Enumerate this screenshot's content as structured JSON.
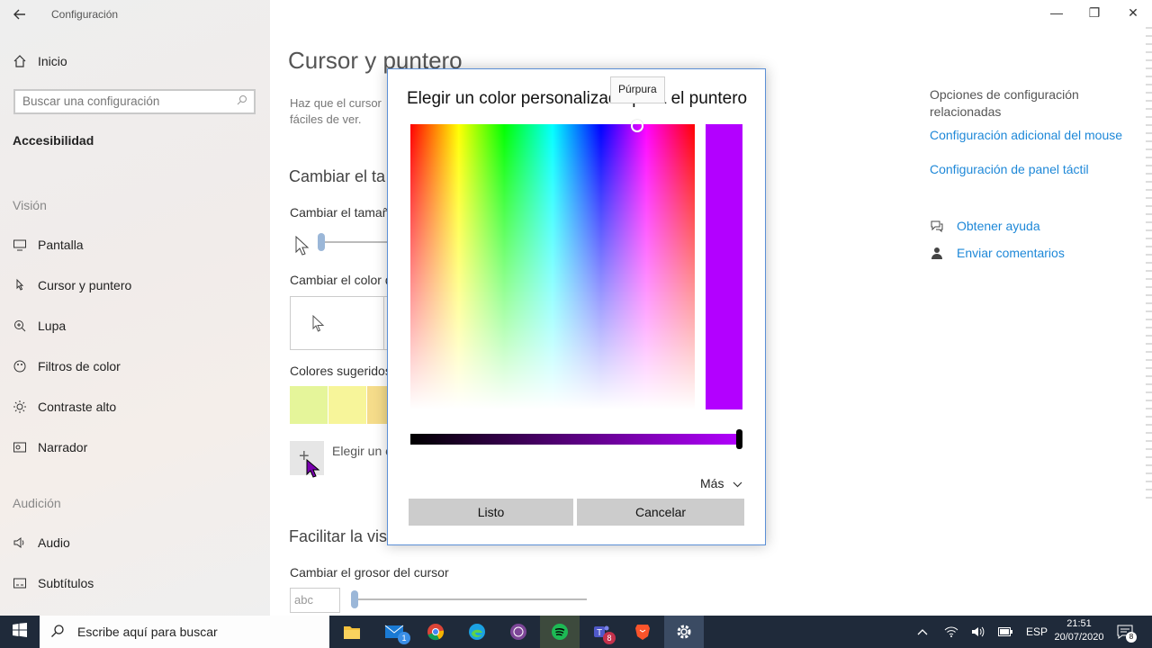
{
  "window": {
    "title": "Configuración",
    "minimize": "—",
    "maximize": "❐",
    "close": "✕"
  },
  "sidebar": {
    "home_label": "Inicio",
    "search_placeholder": "Buscar una configuración",
    "category": "Accesibilidad",
    "section_vision": "Visión",
    "items_vision": [
      {
        "label": "Pantalla",
        "icon": "monitor-icon"
      },
      {
        "label": "Cursor y puntero",
        "icon": "cursor-icon"
      },
      {
        "label": "Lupa",
        "icon": "magnifier-icon"
      },
      {
        "label": "Filtros de color",
        "icon": "color-filter-icon"
      },
      {
        "label": "Contraste alto",
        "icon": "brightness-icon"
      },
      {
        "label": "Narrador",
        "icon": "narrator-icon"
      }
    ],
    "section_audio": "Audición",
    "items_audio": [
      {
        "label": "Audio",
        "icon": "speaker-icon"
      },
      {
        "label": "Subtítulos",
        "icon": "captions-icon"
      }
    ]
  },
  "main": {
    "title": "Cursor y puntero",
    "description": "Haz que el cursor, … fáciles de ver.",
    "desc_line1": "Haz que el cursor",
    "desc_line2": "fáciles de ver.",
    "size_heading": "Cambiar el ta",
    "size_label": "Cambiar el tamañ",
    "color_label": "Cambiar el color d",
    "suggested_label": "Colores sugeridos",
    "suggested_colors": [
      "#e5f59a",
      "#f7f59a",
      "#f5dc8a"
    ],
    "custom_label": "Elegir un c",
    "ease_heading": "Facilitar la vis",
    "thickness_label": "Cambiar el grosor del cursor",
    "thickness_preview": "abc"
  },
  "related": {
    "title": "Opciones de configuración relacionadas",
    "link_mouse": "Configuración adicional del mouse",
    "link_touchpad": "Configuración de panel táctil",
    "help": "Obtener ayuda",
    "feedback": "Enviar comentarios"
  },
  "dialog": {
    "title": "Elegir un color personalizado para el puntero",
    "tooltip": "Púrpura",
    "selected_color": "#b300ff",
    "value_level": 1.0,
    "more_label": "Más",
    "done_label": "Listo",
    "cancel_label": "Cancelar"
  },
  "taskbar": {
    "search_placeholder": "Escribe aquí para buscar",
    "apps": [
      {
        "icon": "file-explorer-icon"
      },
      {
        "icon": "mail-icon",
        "badge": "1"
      },
      {
        "icon": "chrome-icon"
      },
      {
        "icon": "edge-icon"
      },
      {
        "icon": "tor-icon"
      },
      {
        "icon": "spotify-icon"
      },
      {
        "icon": "teams-icon",
        "badge": "8"
      },
      {
        "icon": "brave-icon"
      },
      {
        "icon": "settings-icon"
      }
    ],
    "language": "ESP",
    "time": "21:51",
    "date": "20/07/2020",
    "notification_badge": "8"
  }
}
